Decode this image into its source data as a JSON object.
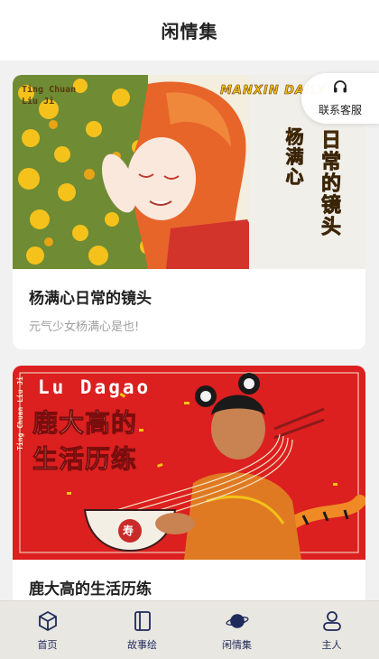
{
  "header": {
    "title": "闲情集"
  },
  "service": {
    "label": "联系客服",
    "icon": "headset-icon"
  },
  "cards": [
    {
      "title": "杨满心日常的镜头",
      "subtitle": "元气少女杨满心是也!",
      "art": {
        "brand_text": "MANXIN DAILY",
        "brand_sub": "Ting Chuan\nLiu Ji",
        "big_chars": "日常的镜头",
        "name_chars": "杨满心"
      }
    },
    {
      "title": "鹿大高的生活历练",
      "art": {
        "latin_title": "Lu Dagao",
        "line1": "鹿大高的",
        "line2": "生活历练",
        "side_text": "Ting Chuan Liu Ji",
        "bowl_char": "寿"
      }
    }
  ],
  "tabbar": {
    "items": [
      {
        "label": "首页",
        "icon": "cube-icon"
      },
      {
        "label": "故事绘",
        "icon": "book-icon"
      },
      {
        "label": "闲情集",
        "icon": "planet-icon"
      },
      {
        "label": "主人",
        "icon": "user-icon"
      }
    ]
  },
  "colors": {
    "accent": "#1e2a5a",
    "poster_red": "#dc1f1f",
    "poster_yellow": "#f2c218"
  }
}
